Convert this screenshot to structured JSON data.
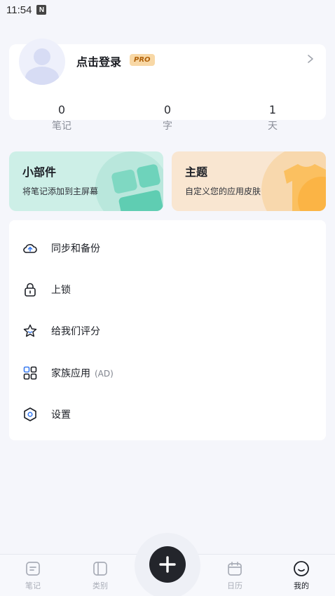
{
  "status_bar": {
    "time": "11:54",
    "notification_badge": "N"
  },
  "profile": {
    "login_label": "点击登录",
    "pro_badge": "PRO",
    "stats": [
      {
        "value": "0",
        "label": "笔记"
      },
      {
        "value": "0",
        "label": "字"
      },
      {
        "value": "1",
        "label": "天"
      }
    ]
  },
  "features": {
    "widget": {
      "title": "小部件",
      "desc": "将笔记添加到主屏幕",
      "color": "#cdefe7"
    },
    "theme": {
      "title": "主题",
      "desc": "自定义您的应用皮肤",
      "color": "#f9e6d1"
    }
  },
  "menu": [
    {
      "label": "同步和备份",
      "sub": "",
      "icon": "cloud-upload-icon"
    },
    {
      "label": "上锁",
      "sub": "",
      "icon": "lock-icon"
    },
    {
      "label": "给我们评分",
      "sub": "",
      "icon": "star-icon"
    },
    {
      "label": "家族应用",
      "sub": "(AD)",
      "icon": "apps-grid-icon"
    },
    {
      "label": "设置",
      "sub": "",
      "icon": "settings-hexagon-icon"
    }
  ],
  "bottom_nav": [
    {
      "label": "笔记",
      "icon": "note-icon",
      "active": false
    },
    {
      "label": "类别",
      "icon": "category-icon",
      "active": false
    },
    {
      "label": "日历",
      "icon": "calendar-icon",
      "active": false
    },
    {
      "label": "我的",
      "icon": "smiley-icon",
      "active": true
    }
  ],
  "fab": {
    "icon": "plus-icon"
  }
}
